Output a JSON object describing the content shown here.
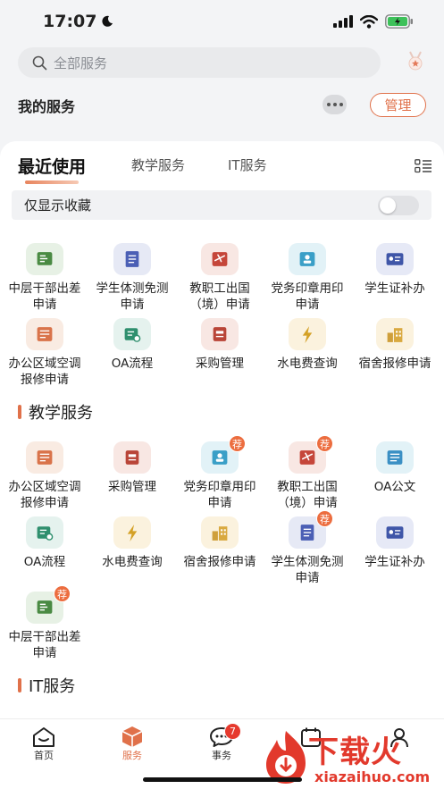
{
  "status_bar": {
    "time": "17:07"
  },
  "search": {
    "placeholder": "全部服务"
  },
  "my_services": {
    "title": "我的服务",
    "manage_label": "管理"
  },
  "tabs": [
    {
      "label": "最近使用"
    },
    {
      "label": "教学服务"
    },
    {
      "label": "IT服务"
    }
  ],
  "favorites_only_label": "仅显示收藏",
  "recent_items": [
    {
      "label": "中层干部出差申请",
      "icon": "cadre-trip-icon"
    },
    {
      "label": "学生体测免测申请",
      "icon": "fitness-exempt-icon"
    },
    {
      "label": "教职工出国（境）申请",
      "icon": "abroad-icon"
    },
    {
      "label": "党务印章用印申请",
      "icon": "seal-icon"
    },
    {
      "label": "学生证补办",
      "icon": "student-card-icon"
    },
    {
      "label": "办公区域空调报修申请",
      "icon": "ac-repair-icon"
    },
    {
      "label": "OA流程",
      "icon": "oa-flow-icon"
    },
    {
      "label": "采购管理",
      "icon": "purchase-icon"
    },
    {
      "label": "水电费查询",
      "icon": "utility-icon"
    },
    {
      "label": "宿舍报修申请",
      "icon": "dorm-repair-icon"
    }
  ],
  "teaching_section": {
    "title": "教学服务"
  },
  "teaching_items": [
    {
      "label": "办公区域空调报修申请",
      "icon": "ac-repair-icon",
      "badge": ""
    },
    {
      "label": "采购管理",
      "icon": "purchase-icon",
      "badge": ""
    },
    {
      "label": "党务印章用印申请",
      "icon": "seal-icon",
      "badge": "荐"
    },
    {
      "label": "教职工出国（境）申请",
      "icon": "abroad-icon",
      "badge": "荐"
    },
    {
      "label": "OA公文",
      "icon": "oa-doc-icon",
      "badge": ""
    },
    {
      "label": "OA流程",
      "icon": "oa-flow-icon",
      "badge": ""
    },
    {
      "label": "水电费查询",
      "icon": "utility-icon",
      "badge": ""
    },
    {
      "label": "宿舍报修申请",
      "icon": "dorm-repair-icon",
      "badge": ""
    },
    {
      "label": "学生体测免测申请",
      "icon": "fitness-exempt-icon",
      "badge": "荐"
    },
    {
      "label": "学生证补办",
      "icon": "student-card-icon",
      "badge": ""
    },
    {
      "label": "中层干部出差申请",
      "icon": "cadre-trip-icon",
      "badge": "荐"
    }
  ],
  "it_section": {
    "title": "IT服务"
  },
  "tabbar": [
    {
      "label": "首页",
      "icon": "home-icon"
    },
    {
      "label": "服务",
      "icon": "service-cube-icon"
    },
    {
      "label": "事务",
      "icon": "chat-icon",
      "badge": "7"
    },
    {
      "label": "",
      "icon": "calendar-icon"
    },
    {
      "label": "",
      "icon": "profile-icon"
    }
  ],
  "watermark": {
    "text": "下载火",
    "url": "xiazaihuo.com"
  },
  "colors": {
    "accent": "#e0714a",
    "badge_red": "#e63a2e"
  }
}
